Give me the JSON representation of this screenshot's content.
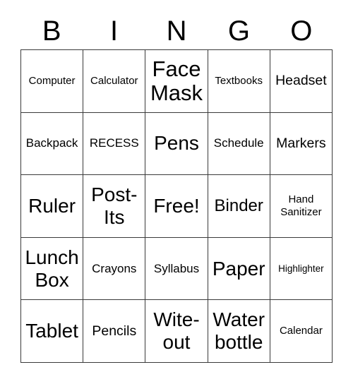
{
  "card": {
    "title": "BINGO",
    "header_letters": [
      "B",
      "I",
      "N",
      "G",
      "O"
    ],
    "colors": {
      "background": "#ffffff",
      "cell_background": "#ffffff",
      "border": "#3a3a3a",
      "text": "#000000"
    },
    "grid": {
      "rows": 5,
      "columns": 5,
      "free_space_position": "center"
    },
    "cells": [
      [
        {
          "label": "Computer",
          "size": "sm",
          "free": false
        },
        {
          "label": "Calculator",
          "size": "sm",
          "free": false
        },
        {
          "label": "Face Mask",
          "size": "huge",
          "free": false
        },
        {
          "label": "Textbooks",
          "size": "sm",
          "free": false
        },
        {
          "label": "Headset",
          "size": "lg",
          "free": false
        }
      ],
      [
        {
          "label": "Backpack",
          "size": "md",
          "free": false
        },
        {
          "label": "RECESS",
          "size": "md",
          "free": false
        },
        {
          "label": "Pens",
          "size": "xxl",
          "free": false
        },
        {
          "label": "Schedule",
          "size": "md",
          "free": false
        },
        {
          "label": "Markers",
          "size": "lg",
          "free": false
        }
      ],
      [
        {
          "label": "Ruler",
          "size": "xxl",
          "free": false
        },
        {
          "label": "Post-Its",
          "size": "xxl",
          "free": false
        },
        {
          "label": "Free!",
          "size": "xxl",
          "free": true
        },
        {
          "label": "Binder",
          "size": "xl",
          "free": false
        },
        {
          "label": "Hand Sanitizer",
          "size": "sm",
          "free": false
        }
      ],
      [
        {
          "label": "Lunch Box",
          "size": "xxl",
          "free": false
        },
        {
          "label": "Crayons",
          "size": "md",
          "free": false
        },
        {
          "label": "Syllabus",
          "size": "md",
          "free": false
        },
        {
          "label": "Paper",
          "size": "xxl",
          "free": false
        },
        {
          "label": "Highlighter",
          "size": "xs",
          "free": false
        }
      ],
      [
        {
          "label": "Tablet",
          "size": "xxl",
          "free": false
        },
        {
          "label": "Pencils",
          "size": "lg",
          "free": false
        },
        {
          "label": "Wite-out",
          "size": "xxl",
          "free": false
        },
        {
          "label": "Water bottle",
          "size": "xxl",
          "free": false
        },
        {
          "label": "Calendar",
          "size": "sm",
          "free": false
        }
      ]
    ]
  }
}
